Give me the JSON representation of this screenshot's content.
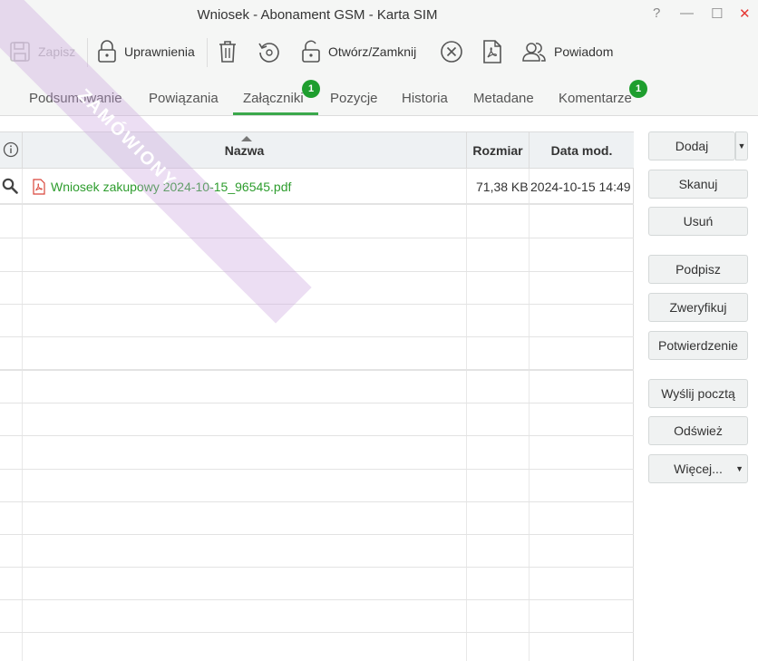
{
  "window": {
    "title": "Wniosek - Abonament GSM - Karta SIM",
    "help": "?",
    "minimize": "—",
    "maximize": "☐",
    "close": "✕"
  },
  "toolbar": {
    "save": "Zapisz",
    "permissions": "Uprawnienia",
    "open_close": "Otwórz/Zamknij",
    "notify": "Powiadom"
  },
  "tabs": [
    {
      "label": "Podsumowanie"
    },
    {
      "label": "Powiązania"
    },
    {
      "label": "Załączniki",
      "badge": "1",
      "active": true
    },
    {
      "label": "Pozycje"
    },
    {
      "label": "Historia"
    },
    {
      "label": "Metadane"
    },
    {
      "label": "Komentarze",
      "badge": "1"
    }
  ],
  "grid": {
    "columns": [
      "Nazwa",
      "Rozmiar",
      "Data mod."
    ],
    "rows": [
      {
        "name": "Wniosek zakupowy 2024-10-15_96545.pdf",
        "size": "71,38 KB",
        "date": "2024-10-15 14:49"
      }
    ]
  },
  "watermark": "ZAMÓWIONY",
  "actions": {
    "add": "Dodaj",
    "scan": "Skanuj",
    "delete": "Usuń",
    "sign": "Podpisz",
    "verify": "Zweryfikuj",
    "confirmation": "Potwierdzenie",
    "send_mail": "Wyślij pocztą",
    "refresh": "Odśwież",
    "more": "Więcej..."
  },
  "colors": {
    "accent": "#3aa84b",
    "badge": "#1e9e2e",
    "link": "#2e9d2e",
    "close": "#e53935"
  }
}
